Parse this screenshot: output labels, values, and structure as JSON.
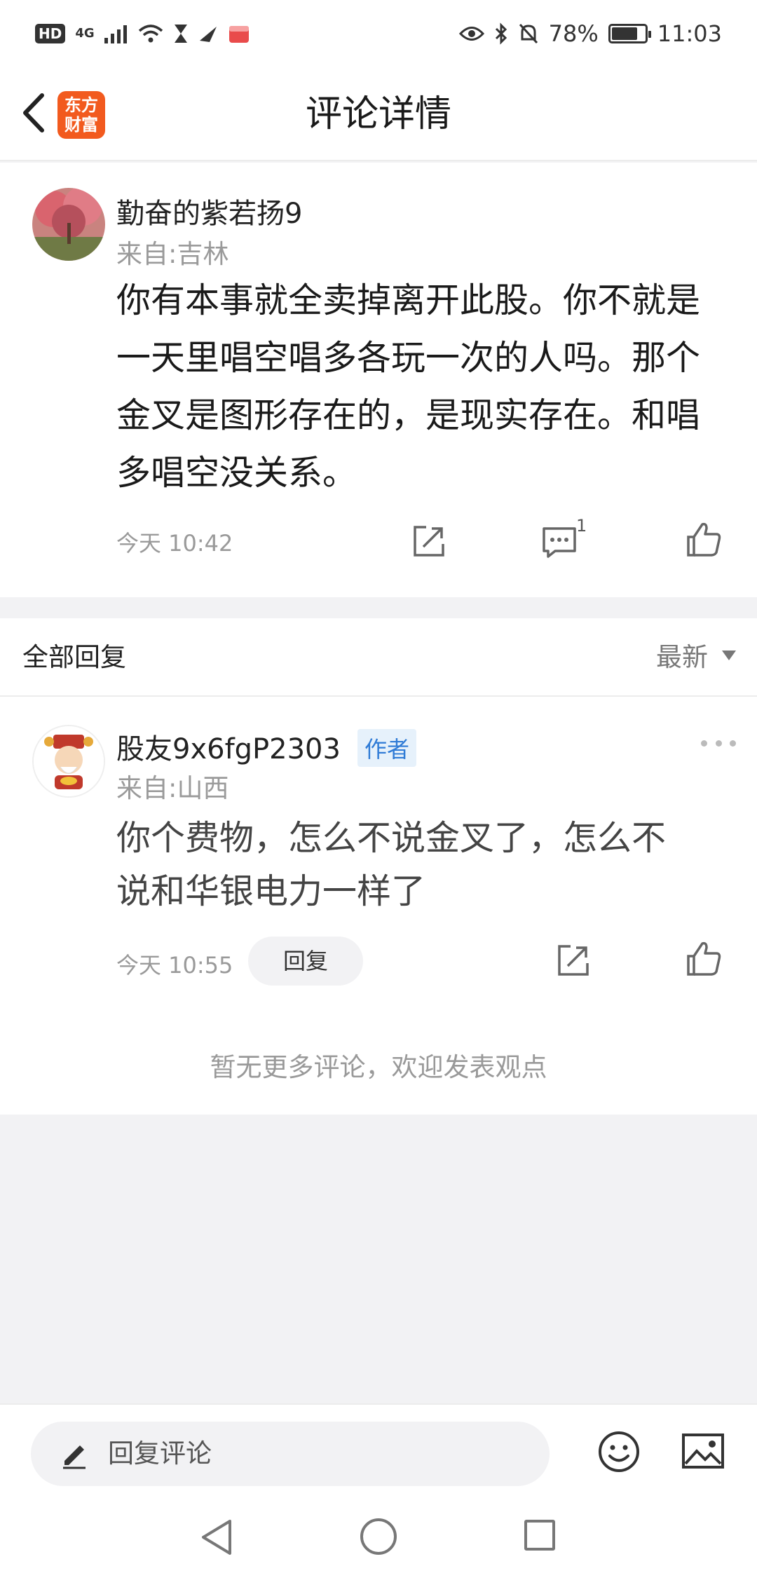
{
  "status_bar": {
    "hd": "HD",
    "network": "4G",
    "battery": "78%",
    "battery_level": 0.78,
    "time": "11:03"
  },
  "header": {
    "title": "评论详情",
    "logo_line1": "东方",
    "logo_line2": "财富",
    "logo_color": "#f25a1e"
  },
  "comment": {
    "username": "勤奋的紫若扬9",
    "location": "来自:吉林",
    "text_lines": [
      "你有本事就全卖掉离开此股。你不就是",
      "一天里唱空唱多各玩一次的人吗。那个",
      "金叉是图形存在的，是现实存在。和唱",
      "多唱空没关系。"
    ],
    "time": "今天 10:42",
    "reply_count": "1",
    "icons": [
      "share-icon",
      "comment-icon",
      "like-icon"
    ]
  },
  "replies": {
    "title": "全部回复",
    "sort": "最新",
    "items": [
      {
        "username": "股友9x6fgP2303",
        "tag": "作者",
        "location": "来自:山西",
        "text_lines": [
          "你个费物，怎么不说金叉了，怎么不",
          "说和华银电力一样了"
        ],
        "time": "今天 10:55",
        "reply_label": "回复"
      }
    ],
    "no_more": "暂无更多评论，欢迎发表观点"
  },
  "bottom_bar": {
    "placeholder": "回复评论",
    "icons": [
      "emoji-icon",
      "image-icon"
    ]
  }
}
